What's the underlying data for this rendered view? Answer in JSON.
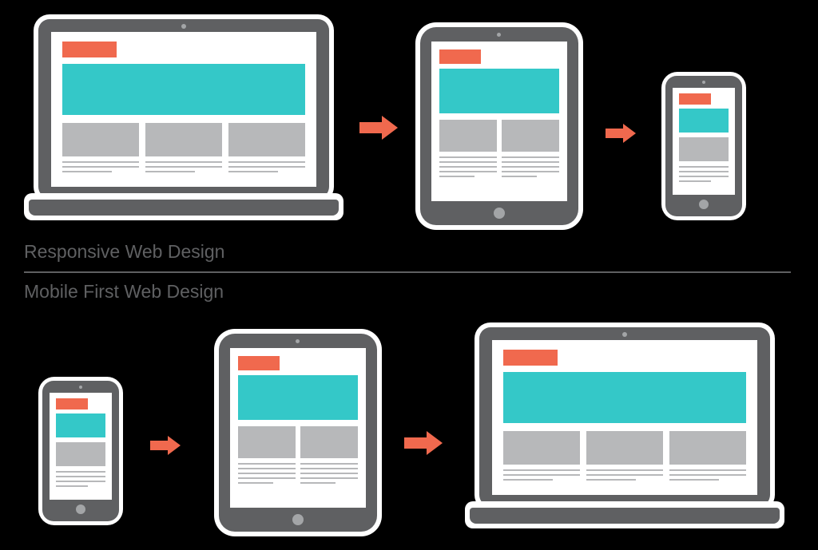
{
  "labels": {
    "top": "Responsive Web Design",
    "bottom": "Mobile First Web Design"
  },
  "colors": {
    "accent_orange": "#f0694e",
    "accent_teal": "#34c8c8",
    "device_grey": "#5f6062",
    "placeholder_grey": "#b7b8ba",
    "background": "#000000",
    "canvas": "#ffffff"
  },
  "diagram": {
    "rows": [
      {
        "name": "responsive",
        "sequence": [
          "laptop",
          "arrow",
          "tablet",
          "arrow",
          "phone"
        ]
      },
      {
        "name": "mobile-first",
        "sequence": [
          "phone",
          "arrow",
          "tablet",
          "arrow",
          "laptop"
        ]
      }
    ],
    "devices": {
      "laptop": {
        "columns": 3,
        "has_logo": true,
        "has_hero": true
      },
      "tablet": {
        "columns": 2,
        "has_logo": true,
        "has_hero": true
      },
      "phone": {
        "columns": 1,
        "has_logo": true,
        "has_hero": true
      }
    }
  }
}
